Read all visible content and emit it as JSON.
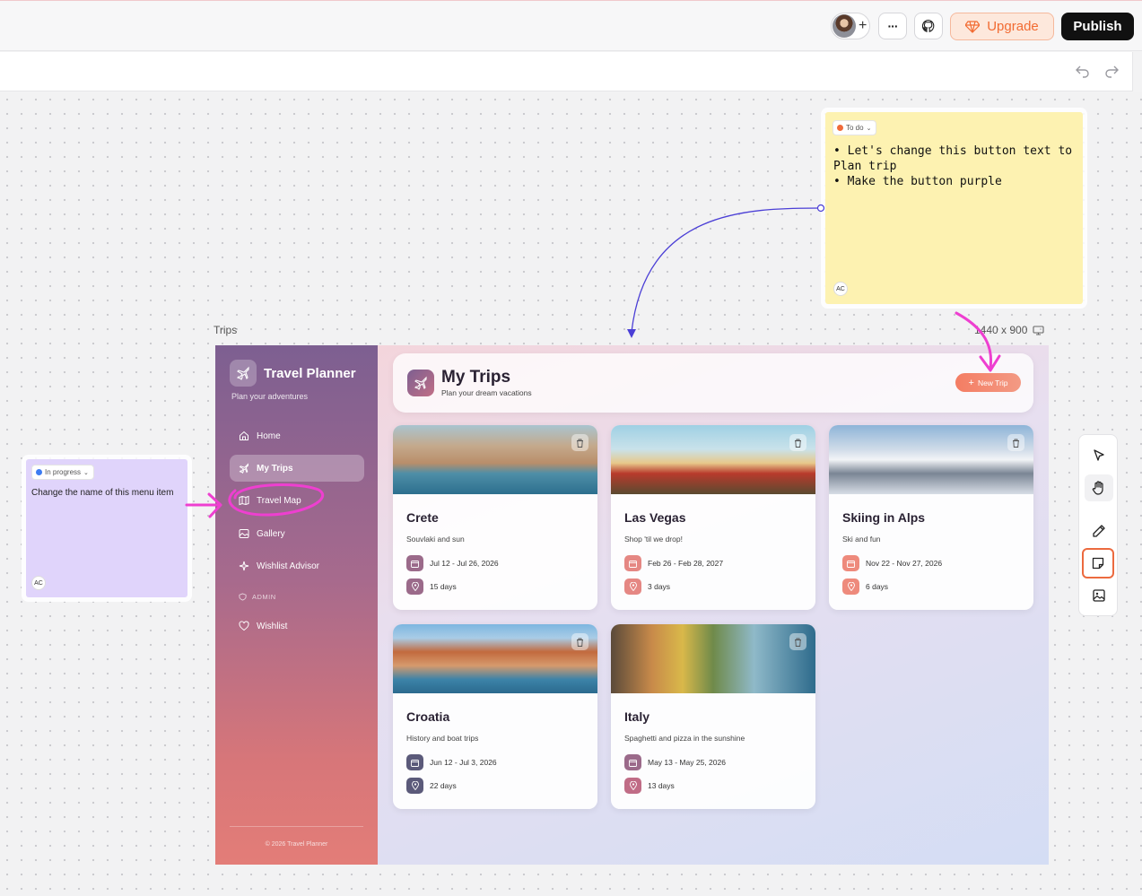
{
  "topbar": {
    "more_label": "···",
    "upgrade_label": "Upgrade",
    "publish_label": "Publish"
  },
  "notes": {
    "yellow": {
      "status": "To do",
      "line1": "• Let's change this button text to Plan trip",
      "line2": "• Make the button purple",
      "initials": "AC"
    },
    "purple": {
      "status": "In progress",
      "text": "Change the name of this menu item",
      "initials": "AC"
    }
  },
  "frame": {
    "label": "Trips",
    "size": "1440 x 900"
  },
  "app": {
    "name": "Travel Planner",
    "tagline": "Plan your adventures",
    "nav": [
      "Home",
      "My Trips",
      "Travel Map",
      "Gallery",
      "Wishlist Advisor"
    ],
    "admin_section": "ADMIN",
    "admin_nav": [
      "Wishlist"
    ],
    "footer": "© 2026 Travel Planner",
    "header_title": "My Trips",
    "header_subtitle": "Plan your dream vacations",
    "new_trip_label": "New Trip"
  },
  "trips": [
    {
      "title": "Crete",
      "desc": "Souvlaki and sun",
      "dates": "Jul 12 - Jul 26, 2026",
      "days": "15 days"
    },
    {
      "title": "Las Vegas",
      "desc": "Shop 'til we drop!",
      "dates": "Feb 26 - Feb 28, 2027",
      "days": "3 days"
    },
    {
      "title": "Skiing in Alps",
      "desc": "Ski and fun",
      "dates": "Nov 22 - Nov 27, 2026",
      "days": "6 days"
    },
    {
      "title": "Croatia",
      "desc": "History and boat trips",
      "dates": "Jun 12 - Jul 3, 2026",
      "days": "22 days"
    },
    {
      "title": "Italy",
      "desc": "Spaghetti and pizza in the sunshine",
      "dates": "May 13 - May 25, 2026",
      "days": "13 days"
    }
  ],
  "colors": {
    "accent_orange": "#f26b32",
    "annotation_pink": "#ee3fd0",
    "connector_blue": "#4b3fd6",
    "todo_dot": "#f06a3a",
    "progress_dot": "#3d7cf2"
  }
}
